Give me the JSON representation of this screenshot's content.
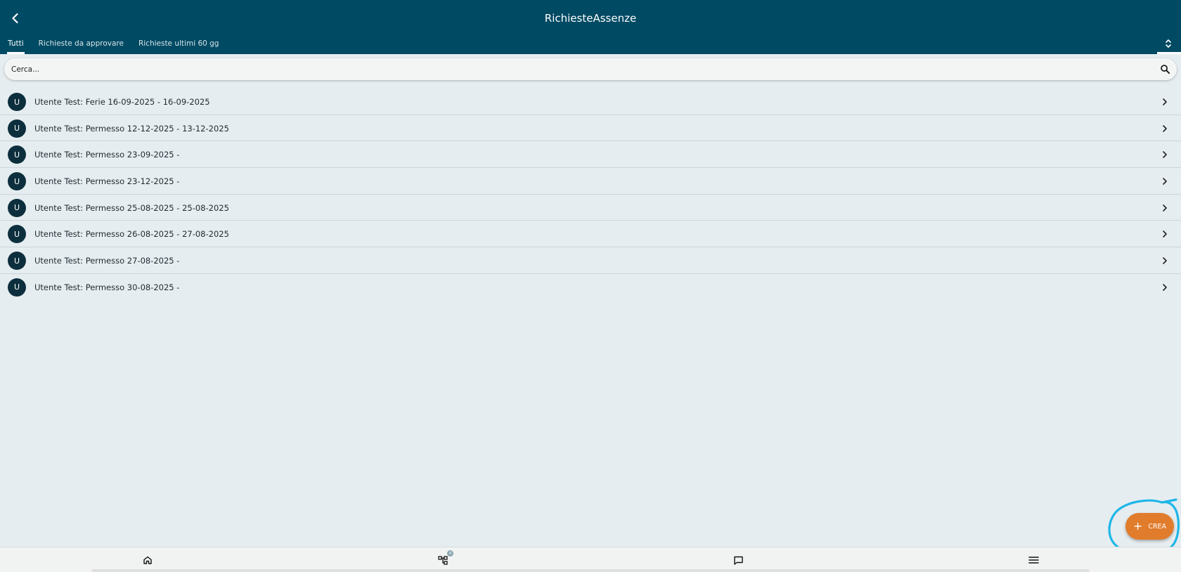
{
  "header": {
    "title": "RichiesteAssenze"
  },
  "tabs": [
    {
      "label": "Tutti",
      "active": true
    },
    {
      "label": "Richieste da approvare",
      "active": false
    },
    {
      "label": "Richieste ultimi 60 gg",
      "active": false
    }
  ],
  "search": {
    "placeholder": "Cerca..."
  },
  "list": [
    {
      "initial": "U",
      "label": "Utente Test: Ferie 16-09-2025 - 16-09-2025"
    },
    {
      "initial": "U",
      "label": "Utente Test: Permesso 12-12-2025 - 13-12-2025"
    },
    {
      "initial": "U",
      "label": "Utente Test: Permesso 23-09-2025 -"
    },
    {
      "initial": "U",
      "label": "Utente Test: Permesso 23-12-2025 -"
    },
    {
      "initial": "U",
      "label": "Utente Test: Permesso 25-08-2025 - 25-08-2025"
    },
    {
      "initial": "U",
      "label": "Utente Test: Permesso 26-08-2025 - 27-08-2025"
    },
    {
      "initial": "U",
      "label": "Utente Test: Permesso 27-08-2025 -"
    },
    {
      "initial": "U",
      "label": "Utente Test: Permesso 30-08-2025 -"
    }
  ],
  "fab": {
    "label": "CREA",
    "icon": "plus-icon"
  },
  "bottom_nav": {
    "items": [
      {
        "icon": "home-icon"
      },
      {
        "icon": "workflow-icon",
        "badge": "4"
      },
      {
        "icon": "chat-icon"
      },
      {
        "icon": "menu-icon"
      }
    ]
  },
  "colors": {
    "header_bg": "#004a63",
    "page_bg": "#e6edf0",
    "avatar_bg": "#0d2f3d",
    "fab_bg": "#e07c2c",
    "highlight": "#1fb6e8"
  }
}
